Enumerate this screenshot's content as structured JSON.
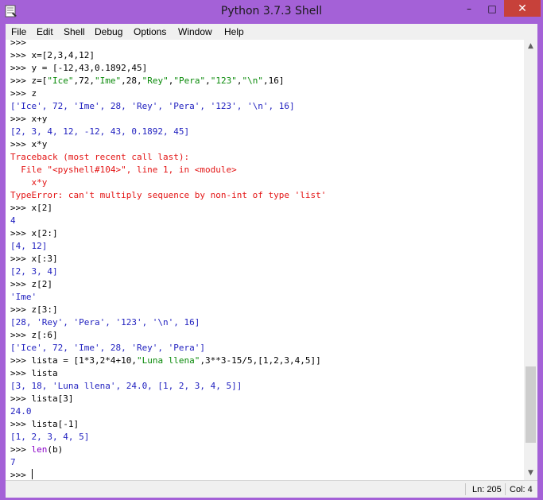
{
  "window": {
    "title": "Python 3.7.3 Shell",
    "controls": {
      "minimize": "–",
      "maximize": "□",
      "close": "✕"
    }
  },
  "menu": [
    "File",
    "Edit",
    "Shell",
    "Debug",
    "Options",
    "Window",
    "Help"
  ],
  "shell_lines": [
    [
      {
        "c": "prompt",
        "t": ">>> "
      }
    ],
    [
      {
        "c": "prompt",
        "t": ">>> x=[2,3,4,12]"
      }
    ],
    [
      {
        "c": "prompt",
        "t": ">>> y = [-12,43,0.1892,45]"
      }
    ],
    [
      {
        "c": "prompt",
        "t": ">>> z=["
      },
      {
        "c": "str",
        "t": "\"Ice\""
      },
      {
        "c": "prompt",
        "t": ",72,"
      },
      {
        "c": "str",
        "t": "\"Ime\""
      },
      {
        "c": "prompt",
        "t": ",28,"
      },
      {
        "c": "str",
        "t": "\"Rey\""
      },
      {
        "c": "prompt",
        "t": ","
      },
      {
        "c": "str",
        "t": "\"Pera\""
      },
      {
        "c": "prompt",
        "t": ","
      },
      {
        "c": "str",
        "t": "\"123\""
      },
      {
        "c": "prompt",
        "t": ","
      },
      {
        "c": "str",
        "t": "\"\\n\""
      },
      {
        "c": "prompt",
        "t": ",16]"
      }
    ],
    [
      {
        "c": "prompt",
        "t": ">>> z"
      }
    ],
    [
      {
        "c": "stdout",
        "t": "['Ice', 72, 'Ime', 28, 'Rey', 'Pera', '123', '\\n', 16]"
      }
    ],
    [
      {
        "c": "prompt",
        "t": ">>> x+y"
      }
    ],
    [
      {
        "c": "stdout",
        "t": "[2, 3, 4, 12, -12, 43, 0.1892, 45]"
      }
    ],
    [
      {
        "c": "prompt",
        "t": ">>> x*y"
      }
    ],
    [
      {
        "c": "err",
        "t": "Traceback (most recent call last):"
      }
    ],
    [
      {
        "c": "err",
        "t": "  File \"<pyshell#104>\", line 1, in <module>"
      }
    ],
    [
      {
        "c": "err",
        "t": "    x*y"
      }
    ],
    [
      {
        "c": "err",
        "t": "TypeError: can't multiply sequence by non-int of type 'list'"
      }
    ],
    [
      {
        "c": "prompt",
        "t": ">>> x[2]"
      }
    ],
    [
      {
        "c": "stdout",
        "t": "4"
      }
    ],
    [
      {
        "c": "prompt",
        "t": ">>> x[2:]"
      }
    ],
    [
      {
        "c": "stdout",
        "t": "[4, 12]"
      }
    ],
    [
      {
        "c": "prompt",
        "t": ">>> x[:3]"
      }
    ],
    [
      {
        "c": "stdout",
        "t": "[2, 3, 4]"
      }
    ],
    [
      {
        "c": "prompt",
        "t": ">>> z[2]"
      }
    ],
    [
      {
        "c": "stdout",
        "t": "'Ime'"
      }
    ],
    [
      {
        "c": "prompt",
        "t": ">>> z[3:]"
      }
    ],
    [
      {
        "c": "stdout",
        "t": "[28, 'Rey', 'Pera', '123', '\\n', 16]"
      }
    ],
    [
      {
        "c": "prompt",
        "t": ">>> z[:6]"
      }
    ],
    [
      {
        "c": "stdout",
        "t": "['Ice', 72, 'Ime', 28, 'Rey', 'Pera']"
      }
    ],
    [
      {
        "c": "prompt",
        "t": ">>> lista = [1*3,2*4+10,"
      },
      {
        "c": "str",
        "t": "\"Luna llena\""
      },
      {
        "c": "prompt",
        "t": ",3**3-15/5,[1,2,3,4,5]]"
      }
    ],
    [
      {
        "c": "prompt",
        "t": ">>> lista"
      }
    ],
    [
      {
        "c": "stdout",
        "t": "[3, 18, 'Luna llena', 24.0, [1, 2, 3, 4, 5]]"
      }
    ],
    [
      {
        "c": "prompt",
        "t": ">>> lista[3]"
      }
    ],
    [
      {
        "c": "stdout",
        "t": "24.0"
      }
    ],
    [
      {
        "c": "prompt",
        "t": ">>> lista[-1]"
      }
    ],
    [
      {
        "c": "stdout",
        "t": "[1, 2, 3, 4, 5]"
      }
    ],
    [
      {
        "c": "prompt",
        "t": ">>> "
      },
      {
        "c": "bi",
        "t": "len"
      },
      {
        "c": "prompt",
        "t": "(b)"
      }
    ],
    [
      {
        "c": "stdout",
        "t": "7"
      }
    ],
    [
      {
        "c": "prompt",
        "t": ">>> "
      }
    ]
  ],
  "status": {
    "line": "Ln: 205",
    "col": "Col: 4"
  },
  "scroll_position": 0.93
}
